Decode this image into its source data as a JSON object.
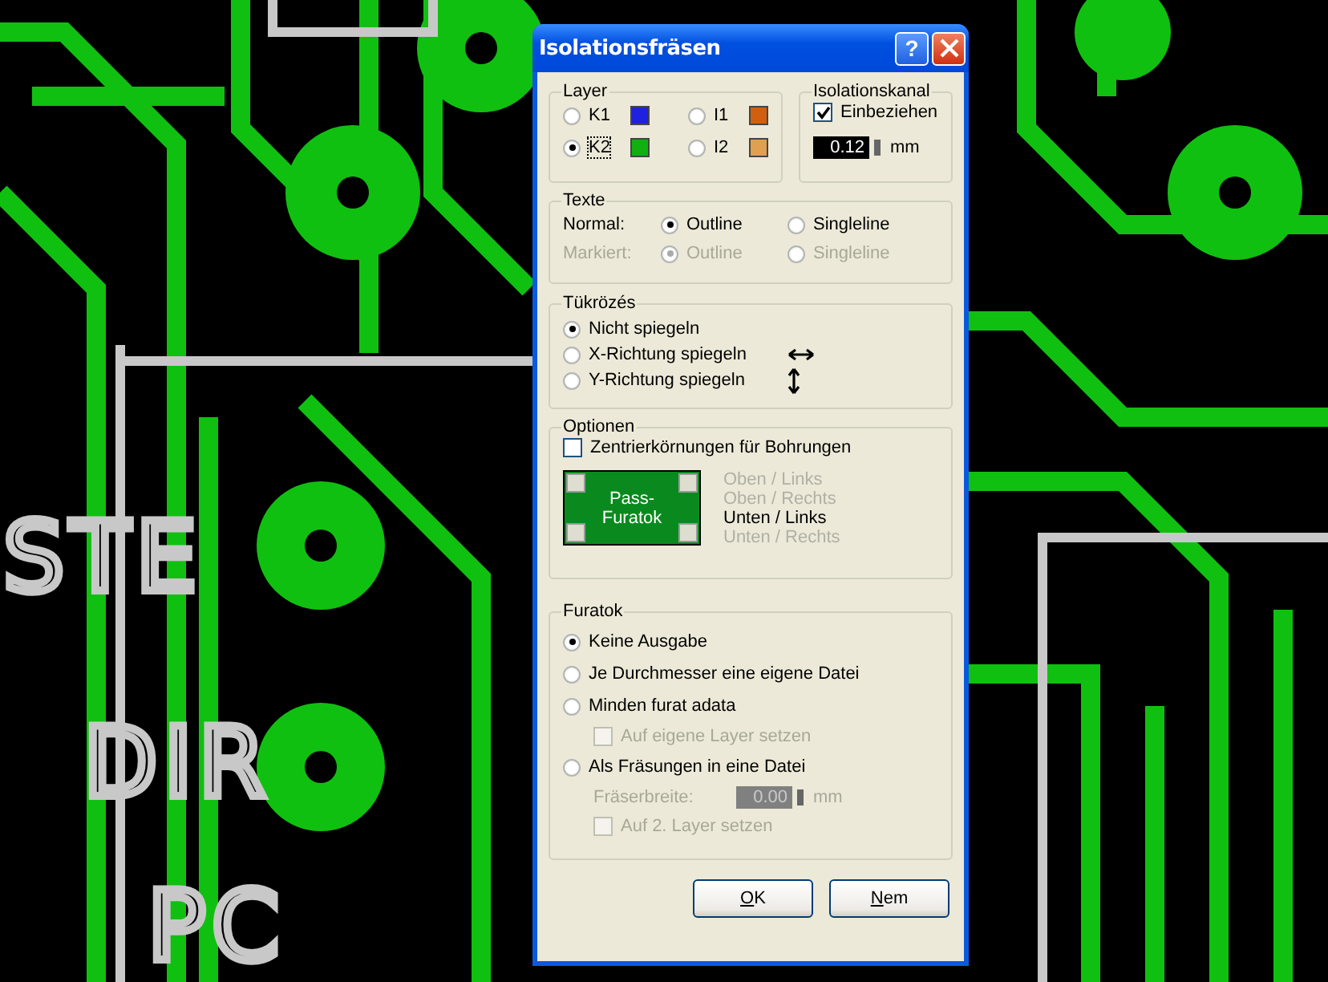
{
  "board": {
    "labels": [
      {
        "text": "STE"
      },
      {
        "text": "DIR"
      },
      {
        "text": "PC"
      }
    ]
  },
  "window": {
    "title": "Isolationsfräsen",
    "help_button": "?"
  },
  "layer": {
    "label": "Layer",
    "options": [
      {
        "label": "K1",
        "color": "#2020e0",
        "selected": false,
        "focused": false
      },
      {
        "label": "I1",
        "color": "#d06010",
        "selected": false,
        "focused": false
      },
      {
        "label": "K2",
        "color": "#10b010",
        "selected": true,
        "focused": true
      },
      {
        "label": "I2",
        "color": "#e0a050",
        "selected": false,
        "focused": false
      }
    ]
  },
  "isolation_channel": {
    "label": "Isolationskanal",
    "include": {
      "label": "Einbeziehen",
      "checked": true
    },
    "width": {
      "value": "0.12",
      "unit": "mm",
      "disabled": false
    }
  },
  "texts": {
    "label": "Texte",
    "rows": [
      {
        "label": "Normal:",
        "disabled": false,
        "options": [
          {
            "label": "Outline",
            "selected": true
          },
          {
            "label": "Singleline",
            "selected": false
          }
        ]
      },
      {
        "label": "Markiert:",
        "disabled": true,
        "options": [
          {
            "label": "Outline",
            "selected": true
          },
          {
            "label": "Singleline",
            "selected": false
          }
        ]
      }
    ]
  },
  "mirroring": {
    "label": "Tükrözés",
    "options": [
      {
        "label": "Nicht spiegeln",
        "selected": true,
        "kind": "none"
      },
      {
        "label": "X-Richtung spiegeln",
        "selected": false,
        "kind": "horizontal"
      },
      {
        "label": "Y-Richtung spiegeln",
        "selected": false,
        "kind": "vertical"
      }
    ]
  },
  "options": {
    "label": "Optionen",
    "centering": {
      "label": "Zentrierkörnungen für Bohrungen",
      "checked": false
    },
    "pass_holes": {
      "label": "Pass-Furatok"
    },
    "positions": [
      {
        "label": "Oben / Links",
        "selected": false
      },
      {
        "label": "Oben / Rechts",
        "selected": false
      },
      {
        "label": "Unten / Links",
        "selected": true
      },
      {
        "label": "Unten / Rechts",
        "selected": false
      }
    ]
  },
  "drills": {
    "label": "Furatok",
    "options": [
      {
        "kind": "radio",
        "label": "Keine Ausgabe",
        "selected": true
      },
      {
        "kind": "radio",
        "label": "Je Durchmesser eine eigene Datei",
        "selected": false
      },
      {
        "kind": "radio",
        "label": "Minden furat adata",
        "selected": false
      },
      {
        "kind": "checkbox",
        "label": "Auf eigene Layer setzen",
        "checked": false,
        "disabled": true
      },
      {
        "kind": "radio",
        "label": "Als Fräsungen in eine Datei",
        "selected": false
      },
      {
        "kind": "field",
        "label": "Fräserbreite:",
        "value": "0.00",
        "unit": "mm",
        "disabled": true
      },
      {
        "kind": "checkbox",
        "label": "Auf 2. Layer setzen",
        "checked": false,
        "disabled": true
      }
    ]
  },
  "buttons": [
    {
      "label": "OK",
      "underline_first": true
    },
    {
      "label": "Nem",
      "underline_first": true
    }
  ]
}
